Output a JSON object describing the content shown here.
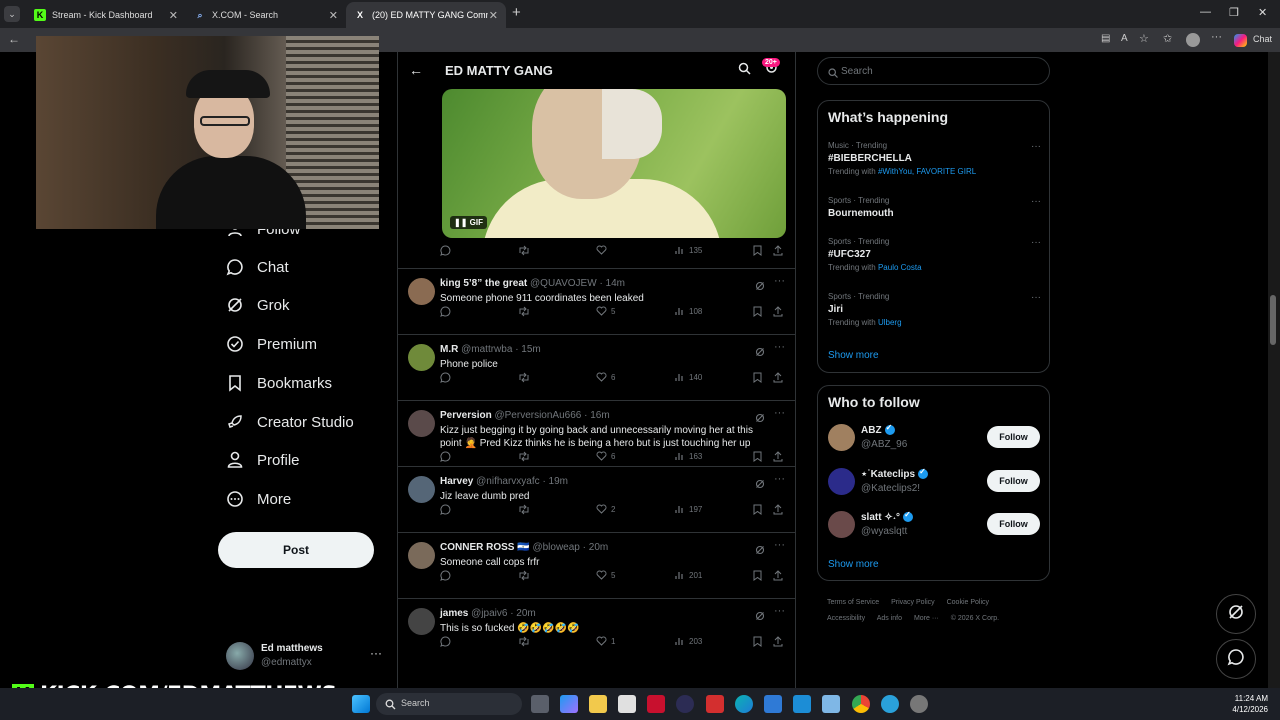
{
  "browser": {
    "tabs": [
      {
        "label": "Stream - Kick Dashboard",
        "icon": "kick-icon",
        "active": false
      },
      {
        "label": "X.COM - Search",
        "icon": "search-icon",
        "active": false
      },
      {
        "label": "(20) ED MATTY GANG Community",
        "icon": "x-icon",
        "active": true
      }
    ],
    "copilot_label": "Chat"
  },
  "nav": {
    "items": [
      {
        "label": "Follow",
        "icon": "follow-icon"
      },
      {
        "label": "Chat",
        "icon": "chat-icon"
      },
      {
        "label": "Grok",
        "icon": "grok-icon"
      },
      {
        "label": "Premium",
        "icon": "premium-icon"
      },
      {
        "label": "Bookmarks",
        "icon": "bookmark-icon"
      },
      {
        "label": "Creator Studio",
        "icon": "rocket-icon"
      },
      {
        "label": "Profile",
        "icon": "profile-icon"
      },
      {
        "label": "More",
        "icon": "more-icon"
      }
    ],
    "post_label": "Post",
    "account": {
      "name": "Ed matthews",
      "handle": "@edmattyx"
    }
  },
  "community": {
    "title": "ED MATTY GANG",
    "badge": "20+",
    "gif_label": "GIF",
    "gif_views": "135"
  },
  "tweets": [
    {
      "name": "king 5’8” the great",
      "handle": "@QUAVOJEW",
      "time": "· 14m",
      "text": "Someone phone 911 coordinates been leaked",
      "likes": "5",
      "views": "108",
      "avatar_color": "#8a6b52"
    },
    {
      "name": "M.R",
      "handle": "@mattrwba",
      "time": "· 15m",
      "text": "Phone police",
      "likes": "6",
      "views": "140",
      "avatar_color": "#6f8a3a"
    },
    {
      "name": "Perversion",
      "handle": "@PerversionAu666",
      "time": "· 16m",
      "text": "Kizz just begging it by going back and unnecessarily moving her at this point 🤦 Pred Kizz thinks he is being a hero but is just touching her up",
      "likes": "6",
      "views": "163",
      "avatar_color": "#5a4a4a"
    },
    {
      "name": "Harvey",
      "handle": "@nifharvxyafc",
      "time": "· 19m",
      "text": "Jiz leave dumb pred",
      "likes": "2",
      "views": "197",
      "avatar_color": "#556677"
    },
    {
      "name": "CONNER ROSS 🇸🇻",
      "handle": "@bloweap",
      "time": "· 20m",
      "text": "Someone call cops frfr",
      "likes": "5",
      "views": "201",
      "avatar_color": "#7a6a5a"
    },
    {
      "name": "james",
      "handle": "@jpaiv6",
      "time": "· 20m",
      "text": "This is so fucked 🤣🤣🤣🤣🤣",
      "likes": "1",
      "views": "203",
      "avatar_color": "#444"
    }
  ],
  "right": {
    "search_placeholder": "Search",
    "whats_happening": "What’s happening",
    "trends": [
      {
        "context": "Music · Trending",
        "title": "#BIEBERCHELLA",
        "with_prefix": "Trending with ",
        "with": "#WithYou, FAVORITE GIRL"
      },
      {
        "context": "Sports · Trending",
        "title": "Bournemouth",
        "with_prefix": "",
        "with": ""
      },
      {
        "context": "Sports · Trending",
        "title": "#UFC327",
        "with_prefix": "Trending with ",
        "with": "Paulo Costa"
      },
      {
        "context": "Sports · Trending",
        "title": "Jiri",
        "with_prefix": "Trending with ",
        "with": "Ulberg"
      }
    ],
    "show_more": "Show more",
    "who_to_follow": "Who to follow",
    "suggestions": [
      {
        "name": "ABZ",
        "handle": "@ABZ_96",
        "follow": "Follow",
        "avatar_color": "#a08060"
      },
      {
        "name": "⋆˙Kateclips",
        "handle": "@Kateclips2!",
        "follow": "Follow",
        "avatar_color": "#2b2b8a"
      },
      {
        "name": "slatt ✧˖°",
        "handle": "@wyaslqtt",
        "follow": "Follow",
        "avatar_color": "#6a4a4a"
      }
    ],
    "footer": [
      "Terms of Service",
      "Privacy Policy",
      "Cookie Policy",
      "Accessibility",
      "Ads info",
      "More ···",
      "© 2026 X Corp."
    ]
  },
  "overlay": {
    "kick_text": "KICK.COM/EDMATTHEWS",
    "kick_letter": "K"
  },
  "taskbar": {
    "search_placeholder": "Search",
    "time": "11:24 AM",
    "date": "4/12/2026"
  }
}
